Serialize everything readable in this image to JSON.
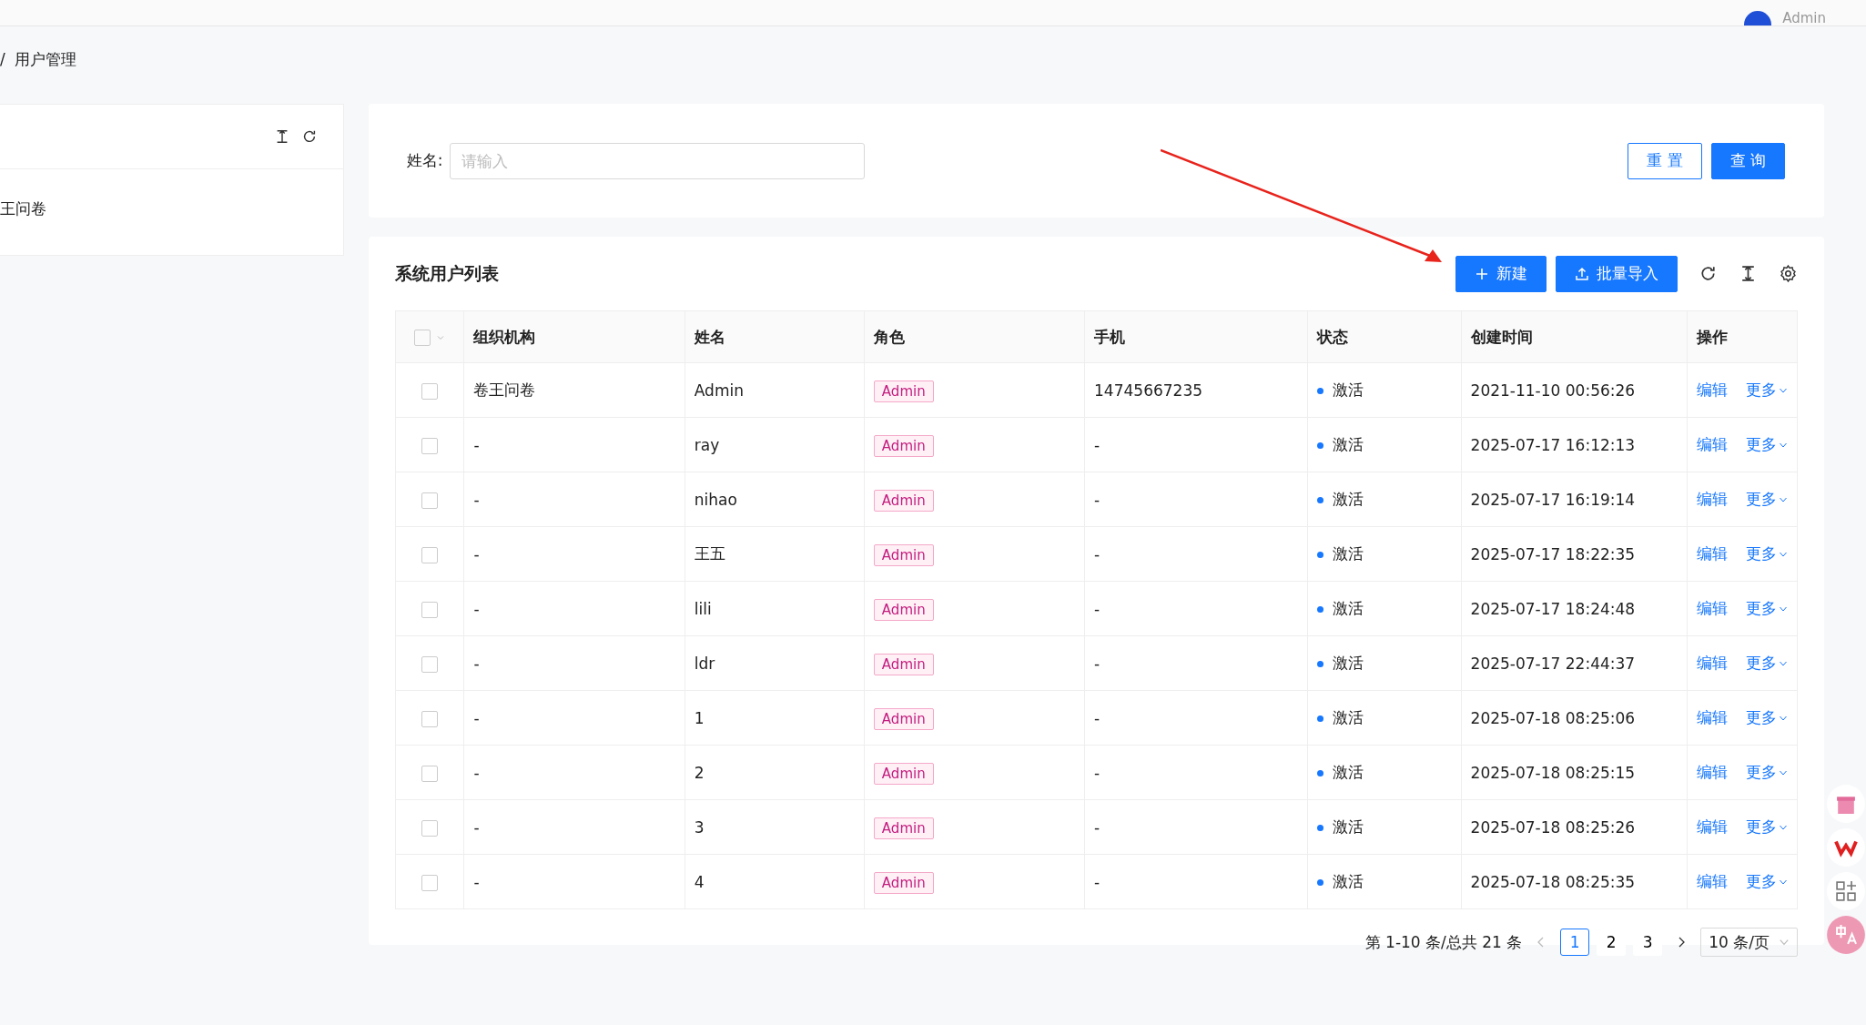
{
  "header": {
    "user": "Admin"
  },
  "breadcrumb": {
    "separator": "/",
    "current": "用户管理"
  },
  "org_tree": {
    "items": [
      {
        "label": "王问卷",
        "selected": false
      }
    ]
  },
  "search": {
    "label": "姓名:",
    "placeholder": "请输入",
    "buttons": [
      {
        "label": "重 置",
        "kind": "default"
      },
      {
        "label": "查 询",
        "kind": "primary"
      }
    ]
  },
  "table_card": {
    "title": "系统用户列表",
    "buttons": [
      {
        "label": "新建",
        "kind": "add"
      },
      {
        "label": "批量导入",
        "kind": "upload"
      }
    ]
  },
  "table": {
    "header_checked": false,
    "columns": [
      "组织机构",
      "姓名",
      "角色",
      "手机",
      "状态",
      "创建时间",
      "操作"
    ],
    "rows": [
      {
        "checked": false,
        "org": "卷王问卷",
        "name": "Admin",
        "role": "Admin",
        "phone": "14745667235",
        "status": "激活",
        "created": "2021-11-10 00:56:26",
        "edit": "编辑",
        "more": "更多"
      },
      {
        "checked": false,
        "org": "-",
        "name": "ray",
        "role": "Admin",
        "phone": "-",
        "status": "激活",
        "created": "2025-07-17 16:12:13",
        "edit": "编辑",
        "more": "更多"
      },
      {
        "checked": false,
        "org": "-",
        "name": "nihao",
        "role": "Admin",
        "phone": "-",
        "status": "激活",
        "created": "2025-07-17 16:19:14",
        "edit": "编辑",
        "more": "更多"
      },
      {
        "checked": false,
        "org": "-",
        "name": "王五",
        "role": "Admin",
        "phone": "-",
        "status": "激活",
        "created": "2025-07-17 18:22:35",
        "edit": "编辑",
        "more": "更多"
      },
      {
        "checked": false,
        "org": "-",
        "name": "lili",
        "role": "Admin",
        "phone": "-",
        "status": "激活",
        "created": "2025-07-17 18:24:48",
        "edit": "编辑",
        "more": "更多"
      },
      {
        "checked": false,
        "org": "-",
        "name": "ldr",
        "role": "Admin",
        "phone": "-",
        "status": "激活",
        "created": "2025-07-17 22:44:37",
        "edit": "编辑",
        "more": "更多"
      },
      {
        "checked": false,
        "org": "-",
        "name": "1",
        "role": "Admin",
        "phone": "-",
        "status": "激活",
        "created": "2025-07-18 08:25:06",
        "edit": "编辑",
        "more": "更多"
      },
      {
        "checked": false,
        "org": "-",
        "name": "2",
        "role": "Admin",
        "phone": "-",
        "status": "激活",
        "created": "2025-07-18 08:25:15",
        "edit": "编辑",
        "more": "更多"
      },
      {
        "checked": false,
        "org": "-",
        "name": "3",
        "role": "Admin",
        "phone": "-",
        "status": "激活",
        "created": "2025-07-18 08:25:26",
        "edit": "编辑",
        "more": "更多"
      },
      {
        "checked": false,
        "org": "-",
        "name": "4",
        "role": "Admin",
        "phone": "-",
        "status": "激活",
        "created": "2025-07-18 08:25:35",
        "edit": "编辑",
        "more": "更多"
      }
    ]
  },
  "pagination": {
    "summary": "第 1-10 条/总共 21 条",
    "pages": [
      {
        "label": "1",
        "selected": true
      },
      {
        "label": "2",
        "selected": false
      },
      {
        "label": "3",
        "selected": false
      }
    ],
    "page_size": "10 条/页"
  }
}
